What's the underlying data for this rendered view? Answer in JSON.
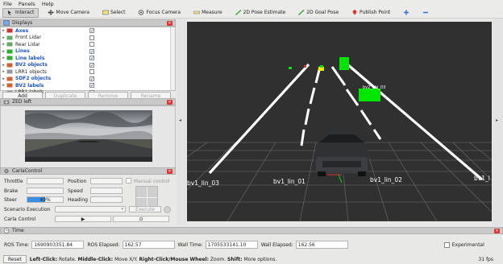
{
  "menu": [
    "File",
    "Panels",
    "Help"
  ],
  "toolbar": {
    "tools": [
      {
        "label": "Interact",
        "active": true
      },
      {
        "label": "Move Camera",
        "active": false
      },
      {
        "label": "Select",
        "active": false
      },
      {
        "label": "Focus Camera",
        "active": false
      },
      {
        "label": "Measure",
        "active": false
      },
      {
        "label": "2D Pose Estimate",
        "active": false
      },
      {
        "label": "2D Goal Pose",
        "active": false
      },
      {
        "label": "Publish Point",
        "active": false
      }
    ]
  },
  "displays": {
    "title": "Displays",
    "items": [
      {
        "label": "Axes",
        "bold": true,
        "checked": true
      },
      {
        "label": "Front Lidar",
        "bold": false,
        "checked": false
      },
      {
        "label": "Rear Lidar",
        "bold": false,
        "checked": false
      },
      {
        "label": "Lines",
        "bold": true,
        "checked": true
      },
      {
        "label": "Line labels",
        "bold": true,
        "checked": true
      },
      {
        "label": "BV2 objects",
        "bold": true,
        "checked": true
      },
      {
        "label": "LRR1 objects",
        "bold": false,
        "checked": false
      },
      {
        "label": "SDF2 objects",
        "bold": true,
        "checked": true
      },
      {
        "label": "BV2 labels",
        "bold": true,
        "checked": true
      },
      {
        "label": "LRR1 labels",
        "bold": false,
        "checked": false
      }
    ],
    "buttons": {
      "add": "Add",
      "duplicate": "Duplicate",
      "remove": "Remove",
      "rename": "Rename"
    }
  },
  "zed": {
    "title": "ZED left"
  },
  "carla": {
    "title": "CarlaControl",
    "throttle": "Throttle",
    "position": "Position",
    "manual": "Manual control",
    "brake": "Brake",
    "speed": "Speed",
    "steer": "Steer",
    "steer_value": "49%",
    "steer_fraction": 0.49,
    "heading": "Heading",
    "scenario": "Scenario Execution",
    "execute": "Execute",
    "carla_control": "Carla Control",
    "play": "▶",
    "stop": "⊙"
  },
  "viewport": {
    "labels": {
      "lin03": "bv1_lin_03",
      "lin01": "bv1_lin_01",
      "lin02": "bv1_lin_02",
      "lin_r": "bv1_l",
      "obj": "bv2_obj_03"
    }
  },
  "time": {
    "title": "Time",
    "ros_time_label": "ROS Time:",
    "ros_time": "1690903351.84",
    "ros_elapsed_label": "ROS Elapsed:",
    "ros_elapsed": "162.57",
    "wall_time_label": "Wall Time:",
    "wall_time": "1705533141.10",
    "wall_elapsed_label": "Wall Elapsed:",
    "wall_elapsed": "162.56",
    "experimental": "Experimental"
  },
  "status": {
    "reset": "Reset",
    "left_click": "Left-Click:",
    "left_click_desc": "Rotate.",
    "middle_click": "Middle-Click:",
    "middle_click_desc": "Move X/Y.",
    "right_click": "Right-Click/Mouse Wheel:",
    "right_click_desc": "Zoom.",
    "shift": "Shift:",
    "shift_desc": "More options.",
    "fps": "31 fps"
  },
  "colors": {
    "accent_blue": "#1e55c8",
    "close_red": "#d33333",
    "marker_green": "#00e600",
    "steer_blue": "#3a8ee6"
  }
}
